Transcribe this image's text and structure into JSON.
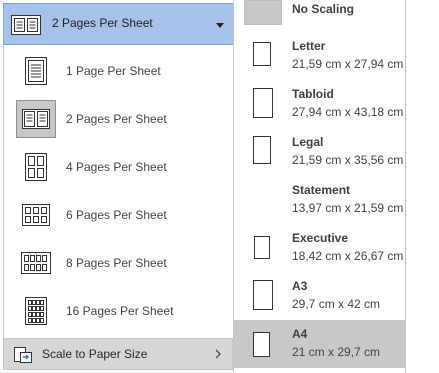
{
  "dropdown": {
    "current": "2 Pages Per Sheet",
    "items": [
      {
        "label": "1 Page Per Sheet",
        "icon": "1-page-per-sheet-icon",
        "selected": false
      },
      {
        "label": "2 Pages Per Sheet",
        "icon": "2-pages-per-sheet-icon",
        "selected": true
      },
      {
        "label": "4 Pages Per Sheet",
        "icon": "4-pages-per-sheet-icon",
        "selected": false
      },
      {
        "label": "6 Pages Per Sheet",
        "icon": "6-pages-per-sheet-icon",
        "selected": false
      },
      {
        "label": "8 Pages Per Sheet",
        "icon": "8-pages-per-sheet-icon",
        "selected": false
      },
      {
        "label": "16 Pages Per Sheet",
        "icon": "16-pages-per-sheet-icon",
        "selected": false
      }
    ],
    "scale_label": "Scale to Paper Size"
  },
  "submenu": {
    "no_scaling": "No Scaling",
    "items": [
      {
        "name": "Letter",
        "dims": "21,59 cm x 27,94 cm",
        "selected": false
      },
      {
        "name": "Tabloid",
        "dims": "27,94 cm x 43,18 cm",
        "selected": false
      },
      {
        "name": "Legal",
        "dims": "21,59 cm x 35,56 cm",
        "selected": false
      },
      {
        "name": "Statement",
        "dims": "13,97 cm x 21,59 cm",
        "selected": false
      },
      {
        "name": "Executive",
        "dims": "18,42 cm x 26,67 cm",
        "selected": false
      },
      {
        "name": "A3",
        "dims": "29,7 cm x 42 cm",
        "selected": false
      },
      {
        "name": "A4",
        "dims": "21 cm x 29,7 cm",
        "selected": true
      }
    ]
  },
  "colors": {
    "header_bg": "#a6c2ea",
    "selected_bg": "#c8c8c8",
    "hover_bg": "#d6d6d6"
  }
}
